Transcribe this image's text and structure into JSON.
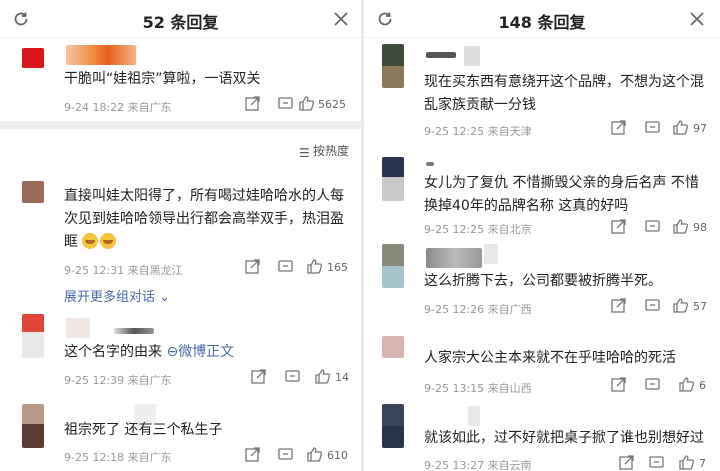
{
  "left": {
    "title": "52 条回复",
    "comments": [
      {
        "text": "干脆叫“娃祖宗”算啦，一语双关",
        "date": "9-24 18:22",
        "location": "来自广东",
        "likes": "5625"
      },
      {
        "text": "直接叫娃太阳得了，所有喝过娃哈哈水的人每次见到娃哈哈领导出行都会高举双手，热泪盈眶",
        "date": "9-25 12:31",
        "location": "来自黑龙江",
        "likes": "165"
      },
      {
        "text": "这个名字的由来",
        "link": "微博正文",
        "date": "9-25 12:39",
        "location": "来自广东",
        "likes": "14"
      },
      {
        "text": "祖宗死了 还有三个私生子",
        "date": "9-25 12:18",
        "location": "来自广东",
        "likes": "610"
      }
    ],
    "sort_label": "按热度",
    "expand_label": "展开更多组对话"
  },
  "right": {
    "title": "148 条回复",
    "comments": [
      {
        "text": "现在买东西有意绕开这个品牌，不想为这个混乱家族贡献一分钱",
        "date": "9-25 12:25",
        "location": "来自天津",
        "likes": "97"
      },
      {
        "text": "女儿为了复仇 不惜撕毁父亲的身后名声 不惜换掉40年的品牌名称 这真的好吗",
        "date": "9-25 12:25",
        "location": "来自北京",
        "likes": "98"
      },
      {
        "text": "这么折腾下去，公司都要被折腾半死。",
        "date": "9-25 12:26",
        "location": "来自广西",
        "likes": "57"
      },
      {
        "text": "人家宗大公主本来就不在乎哇哈哈的死活",
        "date": "9-25 13:15",
        "location": "来自山西",
        "likes": "6"
      },
      {
        "text": "就该如此，过不好就把桌子掀了谁也别想好过",
        "date": "9-25 13:27",
        "location": "来自云南",
        "likes": "7"
      }
    ]
  },
  "colors": {
    "link": "#4a6aa5",
    "meta": "#999999"
  }
}
